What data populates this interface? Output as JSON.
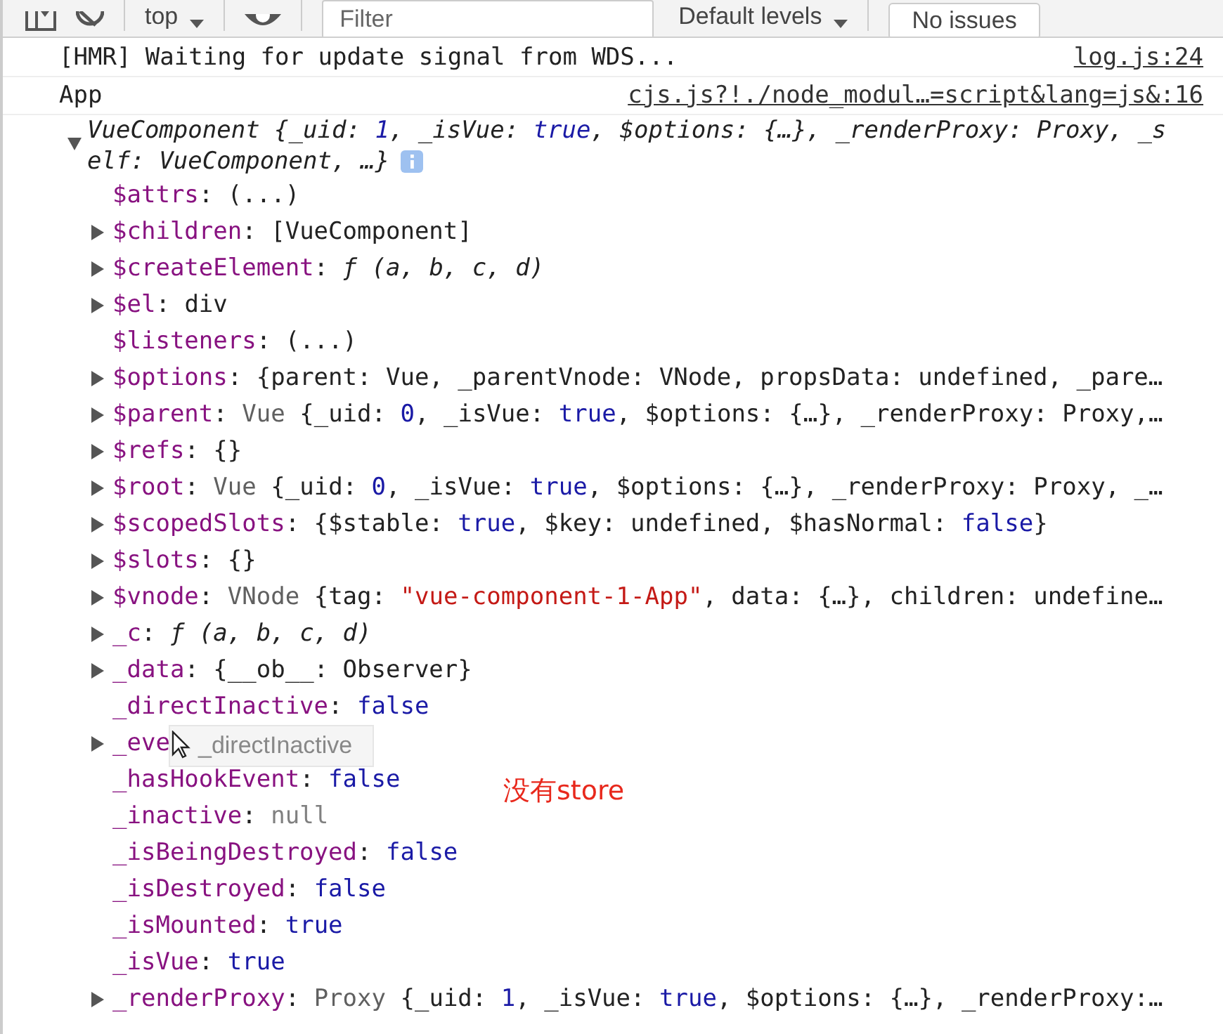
{
  "toolbar": {
    "context": "top",
    "filter": {
      "placeholder": "Filter"
    },
    "levels": "Default levels",
    "issues": "No issues"
  },
  "messages": [
    {
      "text": "[HMR] Waiting for update signal from WDS...",
      "source": "log.js:24"
    },
    {
      "text": "App",
      "source": "cjs.js?!./node_modul…=script&lang=js&:16"
    }
  ],
  "object": {
    "expanded": true,
    "preview": [
      {
        "kind": "plain",
        "text": "VueComponent {_uid: "
      },
      {
        "kind": "bool",
        "text": "1"
      },
      {
        "kind": "plain",
        "text": ", _isVue: "
      },
      {
        "kind": "bool",
        "text": "true"
      },
      {
        "kind": "plain",
        "text": ", $options: {…}, _renderProxy: Proxy, _self: VueComponent, …}"
      }
    ],
    "properties": [
      {
        "key": "$attrs",
        "expandable": false,
        "value": [
          {
            "kind": "plain",
            "text": ": (...)"
          }
        ]
      },
      {
        "key": "$children",
        "expandable": true,
        "value": [
          {
            "kind": "plain",
            "text": ": [VueComponent]"
          }
        ]
      },
      {
        "key": "$createElement",
        "expandable": true,
        "value": [
          {
            "kind": "plain",
            "text": ": "
          },
          {
            "kind": "func",
            "text": "ƒ (a, b, c, d)"
          }
        ]
      },
      {
        "key": "$el",
        "expandable": true,
        "value": [
          {
            "kind": "plain",
            "text": ": div"
          }
        ]
      },
      {
        "key": "$listeners",
        "expandable": false,
        "value": [
          {
            "kind": "plain",
            "text": ": (...)"
          }
        ]
      },
      {
        "key": "$options",
        "expandable": true,
        "value": [
          {
            "kind": "plain",
            "text": ": {parent: Vue, _parentVnode: VNode, propsData: undefined, _pare…"
          }
        ]
      },
      {
        "key": "$parent",
        "expandable": true,
        "value": [
          {
            "kind": "plain",
            "text": ": "
          },
          {
            "kind": "class",
            "text": "Vue"
          },
          {
            "kind": "plain",
            "text": " {_uid: "
          },
          {
            "kind": "bool",
            "text": "0"
          },
          {
            "kind": "plain",
            "text": ", _isVue: "
          },
          {
            "kind": "bool",
            "text": "true"
          },
          {
            "kind": "plain",
            "text": ", $options: {…}, _renderProxy: Proxy,…"
          }
        ]
      },
      {
        "key": "$refs",
        "expandable": true,
        "value": [
          {
            "kind": "plain",
            "text": ": {}"
          }
        ]
      },
      {
        "key": "$root",
        "expandable": true,
        "value": [
          {
            "kind": "plain",
            "text": ": "
          },
          {
            "kind": "class",
            "text": "Vue"
          },
          {
            "kind": "plain",
            "text": " {_uid: "
          },
          {
            "kind": "bool",
            "text": "0"
          },
          {
            "kind": "plain",
            "text": ", _isVue: "
          },
          {
            "kind": "bool",
            "text": "true"
          },
          {
            "kind": "plain",
            "text": ", $options: {…}, _renderProxy: Proxy, _…"
          }
        ]
      },
      {
        "key": "$scopedSlots",
        "expandable": true,
        "value": [
          {
            "kind": "plain",
            "text": ": {$stable: "
          },
          {
            "kind": "bool",
            "text": "true"
          },
          {
            "kind": "plain",
            "text": ", $key: undefined, $hasNormal: "
          },
          {
            "kind": "bool",
            "text": "false"
          },
          {
            "kind": "plain",
            "text": "}"
          }
        ]
      },
      {
        "key": "$slots",
        "expandable": true,
        "value": [
          {
            "kind": "plain",
            "text": ": {}"
          }
        ]
      },
      {
        "key": "$vnode",
        "expandable": true,
        "value": [
          {
            "kind": "plain",
            "text": ": "
          },
          {
            "kind": "class",
            "text": "VNode"
          },
          {
            "kind": "plain",
            "text": " {tag: "
          },
          {
            "kind": "string",
            "text": "\"vue-component-1-App\""
          },
          {
            "kind": "plain",
            "text": ", data: {…}, children: undefine…"
          }
        ]
      },
      {
        "key": "_c",
        "expandable": true,
        "value": [
          {
            "kind": "plain",
            "text": ": "
          },
          {
            "kind": "func",
            "text": "ƒ (a, b, c, d)"
          }
        ]
      },
      {
        "key": "_data",
        "expandable": true,
        "value": [
          {
            "kind": "plain",
            "text": ": {__ob__: Observer}"
          }
        ]
      },
      {
        "key": "_directInactive",
        "expandable": false,
        "value": [
          {
            "kind": "plain",
            "text": ": "
          },
          {
            "kind": "bool",
            "text": "false"
          }
        ]
      },
      {
        "key": "_eve",
        "expandable": true,
        "tooltip": "_directInactive"
      },
      {
        "key": "_hasHookEvent",
        "expandable": false,
        "value": [
          {
            "kind": "plain",
            "text": ": "
          },
          {
            "kind": "bool",
            "text": "false"
          }
        ]
      },
      {
        "key": "_inactive",
        "expandable": false,
        "value": [
          {
            "kind": "plain",
            "text": ": "
          },
          {
            "kind": "null",
            "text": "null"
          }
        ]
      },
      {
        "key": "_isBeingDestroyed",
        "expandable": false,
        "value": [
          {
            "kind": "plain",
            "text": ": "
          },
          {
            "kind": "bool",
            "text": "false"
          }
        ]
      },
      {
        "key": "_isDestroyed",
        "expandable": false,
        "value": [
          {
            "kind": "plain",
            "text": ": "
          },
          {
            "kind": "bool",
            "text": "false"
          }
        ]
      },
      {
        "key": "_isMounted",
        "expandable": false,
        "value": [
          {
            "kind": "plain",
            "text": ": "
          },
          {
            "kind": "bool",
            "text": "true"
          }
        ]
      },
      {
        "key": "_isVue",
        "expandable": false,
        "value": [
          {
            "kind": "plain",
            "text": ": "
          },
          {
            "kind": "bool",
            "text": "true"
          }
        ]
      },
      {
        "key": "_renderProxy",
        "expandable": true,
        "value": [
          {
            "kind": "plain",
            "text": ": "
          },
          {
            "kind": "class",
            "text": "Proxy"
          },
          {
            "kind": "plain",
            "text": " {_uid: "
          },
          {
            "kind": "bool",
            "text": "1"
          },
          {
            "kind": "plain",
            "text": ", _isVue: "
          },
          {
            "kind": "bool",
            "text": "true"
          },
          {
            "kind": "plain",
            "text": ", $options: {…}, _renderProxy:…"
          }
        ]
      }
    ]
  },
  "annotation": "没有store"
}
